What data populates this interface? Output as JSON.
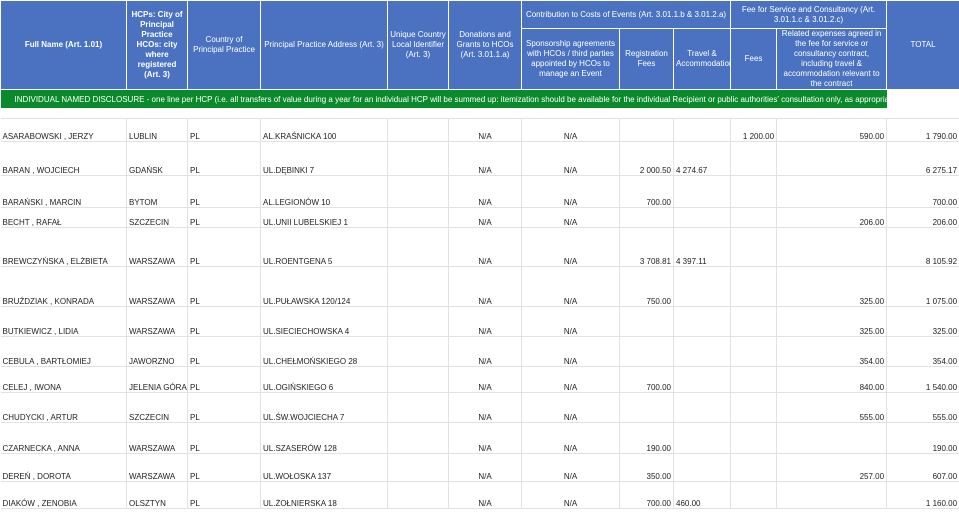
{
  "headers": {
    "full_name": "Full Name (Art. 1.01)",
    "hcps_city": "HCPs: City of Principal Practice HCOs: city where registered (Art. 3)",
    "country": "Country of Principal Practice",
    "address": "Principal Practice Address (Art. 3)",
    "identifier": "Unique Country Local Identifier (Art. 3)",
    "donations": "Donations and Grants to HCOs (Art. 3.01.1.a)",
    "contribution": "Contribution to Costs of Events (Art. 3.01.1.b & 3.01.2.a)",
    "fee_service": "Fee for Service and Consultancy (Art. 3.01.1.c & 3.01.2.c)",
    "sponsorship": "Sponsorship agreements with HCOs / third parties appointed by HCOs to manage an Event",
    "registration": "Registration Fees",
    "travel": "Travel & Accommodation",
    "fees": "Fees",
    "related": "Related expenses agreed in the fee for service or consultancy contract, including travel & accommodation relevant to the contract",
    "total": "TOTAL"
  },
  "banner": "INDIVIDUAL NAMED DISCLOSURE - one line per HCP (i.e. all transfers of value during a year for an individual HCP will be summed up: itemization should be available for the individual Recipient or public authorities' consultation only, as appropriate)",
  "rows": [
    {
      "name": "ASARABOWSKI , JERZY",
      "city": "LUBLIN",
      "country": "PL",
      "address": "AL.KRAŚNICKA 100",
      "identifier": "",
      "donations": "N/A",
      "sponsorship": "N/A",
      "registration": "",
      "travel": "",
      "fees": "1 200.00",
      "related": "590.00",
      "total": "1 790.00"
    },
    {
      "name": "BARAN , WOJCIECH",
      "city": "GDAŃSK",
      "country": "PL",
      "address": "UL.DĘBINKI 7",
      "identifier": "",
      "donations": "N/A",
      "sponsorship": "N/A",
      "registration": "2 000.50",
      "travel": "4 274.67",
      "fees": "",
      "related": "",
      "total": "6 275.17"
    },
    {
      "name": "BARAŃSKI , MARCIN",
      "city": "BYTOM",
      "country": "PL",
      "address": "AL.LEGIONÓW 10",
      "identifier": "",
      "donations": "N/A",
      "sponsorship": "N/A",
      "registration": "700.00",
      "travel": "",
      "fees": "",
      "related": "",
      "total": "700.00"
    },
    {
      "name": "BECHT , RAFAŁ",
      "city": "SZCZECIN",
      "country": "PL",
      "address": "UL.UNII LUBELSKIEJ 1",
      "identifier": "",
      "donations": "N/A",
      "sponsorship": "N/A",
      "registration": "",
      "travel": "",
      "fees": "",
      "related": "206.00",
      "total": "206.00"
    },
    {
      "name": "BREWCZYŃSKA , ELŻBIETA",
      "city": "WARSZAWA",
      "country": "PL",
      "address": "UL.ROENTGENA 5",
      "identifier": "",
      "donations": "N/A",
      "sponsorship": "N/A",
      "registration": "3 708.81",
      "travel": "4 397.11",
      "fees": "",
      "related": "",
      "total": "8 105.92"
    },
    {
      "name": "BRUŹDZIAK , KONRADA",
      "city": "WARSZAWA",
      "country": "PL",
      "address": "UL.PUŁAWSKA 120/124",
      "identifier": "",
      "donations": "N/A",
      "sponsorship": "N/A",
      "registration": "750.00",
      "travel": "",
      "fees": "",
      "related": "325.00",
      "total": "1 075.00"
    },
    {
      "name": "BUTKIEWICZ , LIDIA",
      "city": "WARSZAWA",
      "country": "PL",
      "address": "UL.SIECIECHOWSKA 4",
      "identifier": "",
      "donations": "N/A",
      "sponsorship": "N/A",
      "registration": "",
      "travel": "",
      "fees": "",
      "related": "325.00",
      "total": "325.00"
    },
    {
      "name": "CEBULA , BARTŁOMIEJ",
      "city": "JAWORZNO",
      "country": "PL",
      "address": "UL.CHEŁMOŃSKIEGO 28",
      "identifier": "",
      "donations": "N/A",
      "sponsorship": "N/A",
      "registration": "",
      "travel": "",
      "fees": "",
      "related": "354.00",
      "total": "354.00"
    },
    {
      "name": "CELEJ , IWONA",
      "city": "JELENIA GÓRA",
      "country": "PL",
      "address": "UL.OGIŃSKIEGO 6",
      "identifier": "",
      "donations": "N/A",
      "sponsorship": "N/A",
      "registration": "700.00",
      "travel": "",
      "fees": "",
      "related": "840.00",
      "total": "1 540.00"
    },
    {
      "name": "CHUDYCKI , ARTUR",
      "city": "SZCZECIN",
      "country": "PL",
      "address": "UL.ŚW.WOJCIECHA 7",
      "identifier": "",
      "donations": "N/A",
      "sponsorship": "N/A",
      "registration": "",
      "travel": "",
      "fees": "",
      "related": "555.00",
      "total": "555.00"
    },
    {
      "name": "CZARNECKA , ANNA",
      "city": "WARSZAWA",
      "country": "PL",
      "address": "UL.SZASERÓW 128",
      "identifier": "",
      "donations": "N/A",
      "sponsorship": "N/A",
      "registration": "190.00",
      "travel": "",
      "fees": "",
      "related": "",
      "total": "190.00"
    },
    {
      "name": "DEREŃ , DOROTA",
      "city": "WARSZAWA",
      "country": "PL",
      "address": "UL.WOŁOSKA 137",
      "identifier": "",
      "donations": "N/A",
      "sponsorship": "N/A",
      "registration": "350.00",
      "travel": "",
      "fees": "",
      "related": "257.00",
      "total": "607.00"
    },
    {
      "name": "DIAKÓW , ZENOBIA",
      "city": "OLSZTYN",
      "country": "PL",
      "address": "UL.ŻOŁNIERSKA 18",
      "identifier": "",
      "donations": "N/A",
      "sponsorship": "N/A",
      "registration": "700.00",
      "travel": "460.00",
      "fees": "",
      "related": "",
      "total": "1 160.00"
    }
  ]
}
